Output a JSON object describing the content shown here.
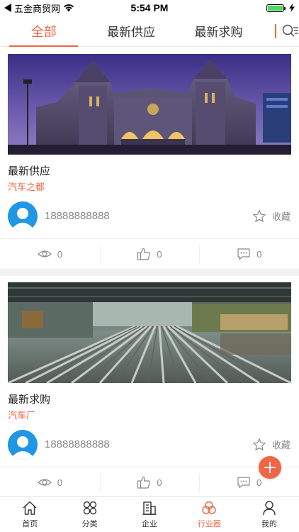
{
  "status_bar": {
    "carrier": "五金商贸网",
    "time": "5:54 PM"
  },
  "tabs": [
    {
      "label": "全部",
      "active": true
    },
    {
      "label": "最新供应",
      "active": false
    },
    {
      "label": "最新求购",
      "active": false
    }
  ],
  "posts": [
    {
      "title": "最新供应",
      "location": "汽车之都",
      "phone": "18888888888",
      "favorite_label": "收藏",
      "views": "0",
      "likes": "0",
      "comments": "0"
    },
    {
      "title": "最新求购",
      "location": "汽车厂",
      "phone": "18888888888",
      "favorite_label": "收藏",
      "views": "0",
      "likes": "0",
      "comments": "0"
    }
  ],
  "fab_icon": "plus-icon",
  "bottom_nav": [
    {
      "label": "首页",
      "icon": "home-icon",
      "active": false
    },
    {
      "label": "分类",
      "icon": "category-icon",
      "active": false
    },
    {
      "label": "企业",
      "icon": "building-icon",
      "active": false
    },
    {
      "label": "行业圈",
      "icon": "circles-icon",
      "active": true
    },
    {
      "label": "我的",
      "icon": "user-icon",
      "active": false
    }
  ],
  "colors": {
    "accent": "#f06543",
    "avatar": "#1f97e4"
  }
}
